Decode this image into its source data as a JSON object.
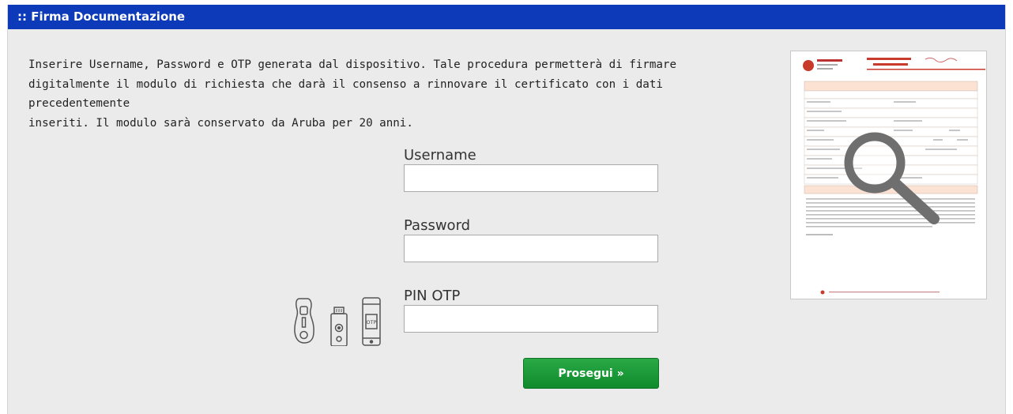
{
  "header": {
    "title": ":: Firma Documentazione"
  },
  "intro": {
    "line1": "Inserire Username, Password e OTP generata dal dispositivo. Tale procedura permetterà di firmare",
    "line2": "digitalmente il modulo di richiesta che darà il consenso a rinnovare il certificato con i dati precedentemente",
    "line3": "inseriti. Il modulo sarà conservato da Aruba per 20 anni."
  },
  "form": {
    "username_label": "Username",
    "username_value": "",
    "password_label": "Password",
    "password_value": "",
    "pin_label": "PIN OTP",
    "pin_value": ""
  },
  "devices": {
    "otp_text": "OTP"
  },
  "submit": {
    "label": "Prosegui »"
  },
  "icons": [
    "otp-keyfob-icon",
    "usb-token-icon",
    "smartphone-otp-icon",
    "magnifier-icon"
  ],
  "colors": {
    "header_bg": "#0d3ab8",
    "button_green": "#179434",
    "panel_bg": "#ebebeb"
  }
}
